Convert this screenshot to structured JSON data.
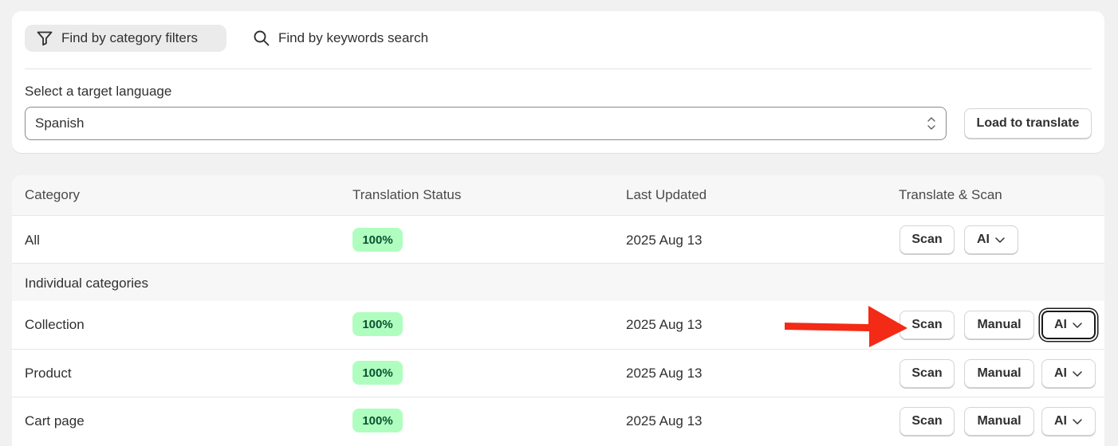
{
  "filters": {
    "category_tab_label": "Find by category filters",
    "keyword_tab_label": "Find by keywords search"
  },
  "language": {
    "label": "Select a target language",
    "selected": "Spanish",
    "load_button": "Load to translate"
  },
  "table": {
    "headers": [
      "Category",
      "Translation Status",
      "Last Updated",
      "Translate & Scan"
    ],
    "all_row": {
      "category": "All",
      "status": "100%",
      "updated": "2025 Aug 13",
      "scan": "Scan",
      "ai": "AI"
    },
    "group_label": "Individual categories",
    "rows": [
      {
        "category": "Collection",
        "status": "100%",
        "updated": "2025 Aug 13",
        "scan": "Scan",
        "manual": "Manual",
        "ai": "AI"
      },
      {
        "category": "Product",
        "status": "100%",
        "updated": "2025 Aug 13",
        "scan": "Scan",
        "manual": "Manual",
        "ai": "AI"
      },
      {
        "category": "Cart page",
        "status": "100%",
        "updated": "2025 Aug 13",
        "scan": "Scan",
        "manual": "Manual",
        "ai": "AI"
      }
    ]
  },
  "colors": {
    "badge_bg": "#affebf",
    "badge_text": "#0c5132",
    "annotation_arrow": "#f32a16"
  }
}
